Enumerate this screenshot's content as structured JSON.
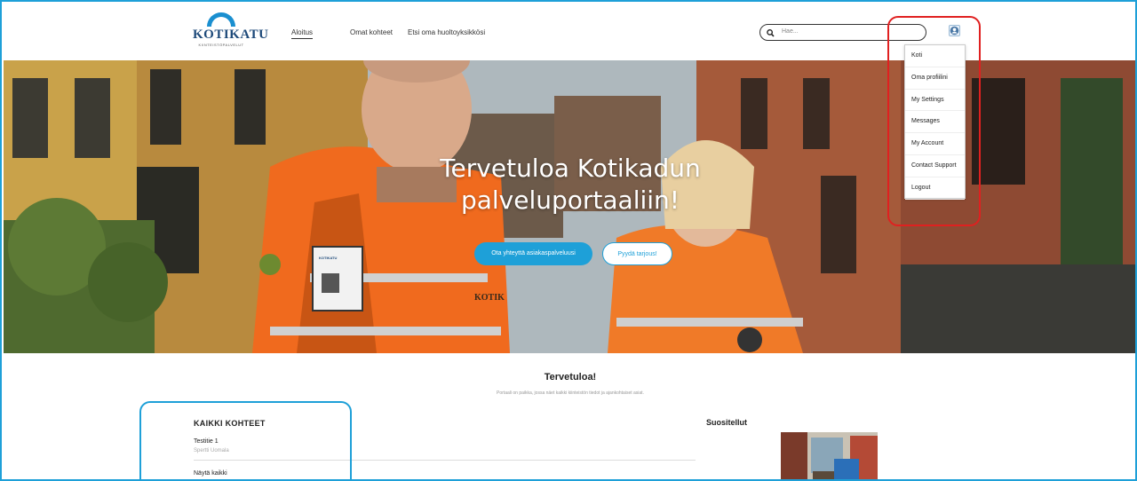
{
  "header": {
    "logo_text": "KOTIKATU",
    "logo_subtext": "KIINTEISTÖPALVELUT",
    "nav": [
      "Aloitus",
      "Omat kohteet",
      "Etsi oma huoltoyksikkösi"
    ],
    "search_placeholder": "Hae..."
  },
  "user_menu": {
    "items": [
      "Koti",
      "Oma profiilini",
      "My Settings",
      "Messages",
      "My Account",
      "Contact Support",
      "Logout"
    ]
  },
  "hero": {
    "title_line1": "Tervetuloa Kotikadun",
    "title_line2": "palveluportaaliin!",
    "primary_button": "Ota yhteyttä asiakaspalveluusi",
    "secondary_button": "Pyydä tarjous!",
    "badge_text": "KOTIKATU",
    "vest_text": "KOTIK"
  },
  "welcome": {
    "title": "Tervetuloa!",
    "text": "Portaali on paikka, jossa näet kaikki kiinteistön tiedot ja ajankohtaiset asiat."
  },
  "all_properties": {
    "heading": "KAIKKI KOHTEET",
    "items": [
      {
        "title": "Testitie 1",
        "subtitle": "Spertti Uomala"
      }
    ],
    "show_all": "Näytä kaikki"
  },
  "recommended": {
    "heading": "Suositellut"
  },
  "colors": {
    "accent": "#1ea0d8",
    "highlight_red": "#e02020",
    "logo_blue": "#1e4a7a"
  }
}
